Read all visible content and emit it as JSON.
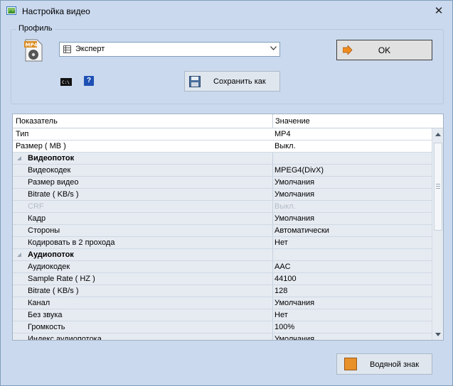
{
  "window": {
    "title": "Настройка видео",
    "close_label": "✕"
  },
  "profile": {
    "group_label": "Профиль",
    "icon": "mp4-file-icon",
    "icon_text": "MP4",
    "selected_profile": "Эксперт",
    "ok_label": "OK",
    "save_as_label": "Сохранить как",
    "help_label": "?"
  },
  "grid": {
    "columns": [
      "Показатель",
      "Значение"
    ],
    "rows": [
      {
        "kind": "top",
        "name": "Тип",
        "value": "MP4"
      },
      {
        "kind": "top",
        "name": "Размер ( MB )",
        "value": "Выкл."
      },
      {
        "kind": "cat",
        "name": "Видеопоток",
        "value": ""
      },
      {
        "kind": "child",
        "name": "Видеокодек",
        "value": "MPEG4(DivX)"
      },
      {
        "kind": "child",
        "name": "Размер видео",
        "value": "Умолчания"
      },
      {
        "kind": "child",
        "name": "Bitrate ( KB/s )",
        "value": "Умолчания"
      },
      {
        "kind": "child disabled",
        "name": "CRF",
        "value": "Выкл."
      },
      {
        "kind": "child",
        "name": "Кадр",
        "value": "Умолчания"
      },
      {
        "kind": "child",
        "name": "Стороны",
        "value": "Автоматически"
      },
      {
        "kind": "child",
        "name": "Кодировать в 2 прохода",
        "value": "Нет"
      },
      {
        "kind": "cat",
        "name": "Аудиопоток",
        "value": ""
      },
      {
        "kind": "child",
        "name": "Аудиокодек",
        "value": "AAC"
      },
      {
        "kind": "child",
        "name": "Sample Rate ( HZ )",
        "value": "44100"
      },
      {
        "kind": "child",
        "name": "Bitrate ( KB/s )",
        "value": "128"
      },
      {
        "kind": "child",
        "name": "Канал",
        "value": "Умолчания"
      },
      {
        "kind": "child",
        "name": "Без звука",
        "value": "Нет"
      },
      {
        "kind": "child",
        "name": "Громкость",
        "value": "100%"
      },
      {
        "kind": "child",
        "name": "Индекс аудиопотока",
        "value": "Умолчания"
      }
    ]
  },
  "watermark": {
    "label": "Водяной знак"
  },
  "colors": {
    "window_bg": "#cad9ee",
    "grid_bg": "#e6ebf2",
    "ok_arrow": "#f08c1e"
  }
}
